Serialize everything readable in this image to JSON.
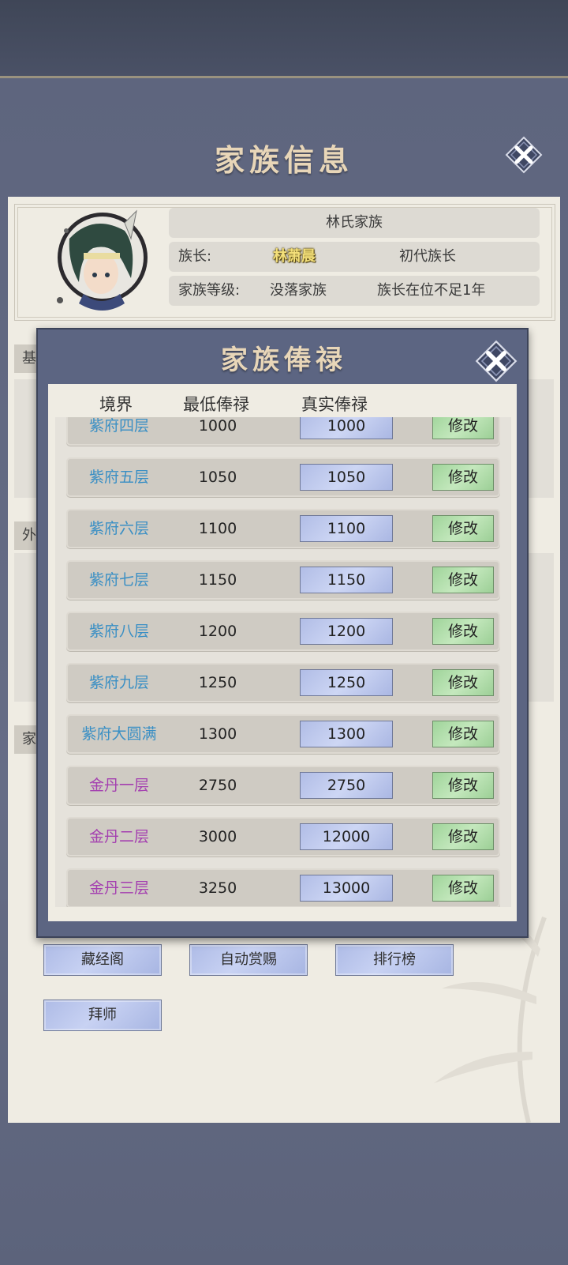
{
  "main": {
    "title": "家族信息"
  },
  "family": {
    "name": "林氏家族",
    "leader_label": "族长:",
    "leader_name": "林萧晨",
    "leader_title": "初代族长",
    "level_label": "家族等级:",
    "level_value": "没落家族",
    "tenure": "族长在位不足1年"
  },
  "side_tabs": [
    "基",
    "外",
    "家"
  ],
  "bottom_buttons": [
    "藏经阁",
    "自动赏赐",
    "排行榜",
    "拜师"
  ],
  "modal": {
    "title": "家族俸禄",
    "columns": [
      "境界",
      "最低俸禄",
      "真实俸禄"
    ],
    "edit_label": "修改",
    "rows": [
      {
        "realm": "紫府四层",
        "min": "1000",
        "real": "1000",
        "tier": "zifu"
      },
      {
        "realm": "紫府五层",
        "min": "1050",
        "real": "1050",
        "tier": "zifu"
      },
      {
        "realm": "紫府六层",
        "min": "1100",
        "real": "1100",
        "tier": "zifu"
      },
      {
        "realm": "紫府七层",
        "min": "1150",
        "real": "1150",
        "tier": "zifu"
      },
      {
        "realm": "紫府八层",
        "min": "1200",
        "real": "1200",
        "tier": "zifu"
      },
      {
        "realm": "紫府九层",
        "min": "1250",
        "real": "1250",
        "tier": "zifu"
      },
      {
        "realm": "紫府大圆满",
        "min": "1300",
        "real": "1300",
        "tier": "zifu"
      },
      {
        "realm": "金丹一层",
        "min": "2750",
        "real": "2750",
        "tier": "jindan"
      },
      {
        "realm": "金丹二层",
        "min": "3000",
        "real": "12000",
        "tier": "jindan"
      },
      {
        "realm": "金丹三层",
        "min": "3250",
        "real": "13000",
        "tier": "jindan"
      }
    ]
  },
  "colors": {
    "zifu_text": "#3a8fc4",
    "jindan_text": "#a43fb0",
    "leader_name": "#f4e07a",
    "title_text": "#e8d6b8"
  },
  "icons": {
    "close": "close-icon",
    "avatar": "avatar-portrait"
  }
}
